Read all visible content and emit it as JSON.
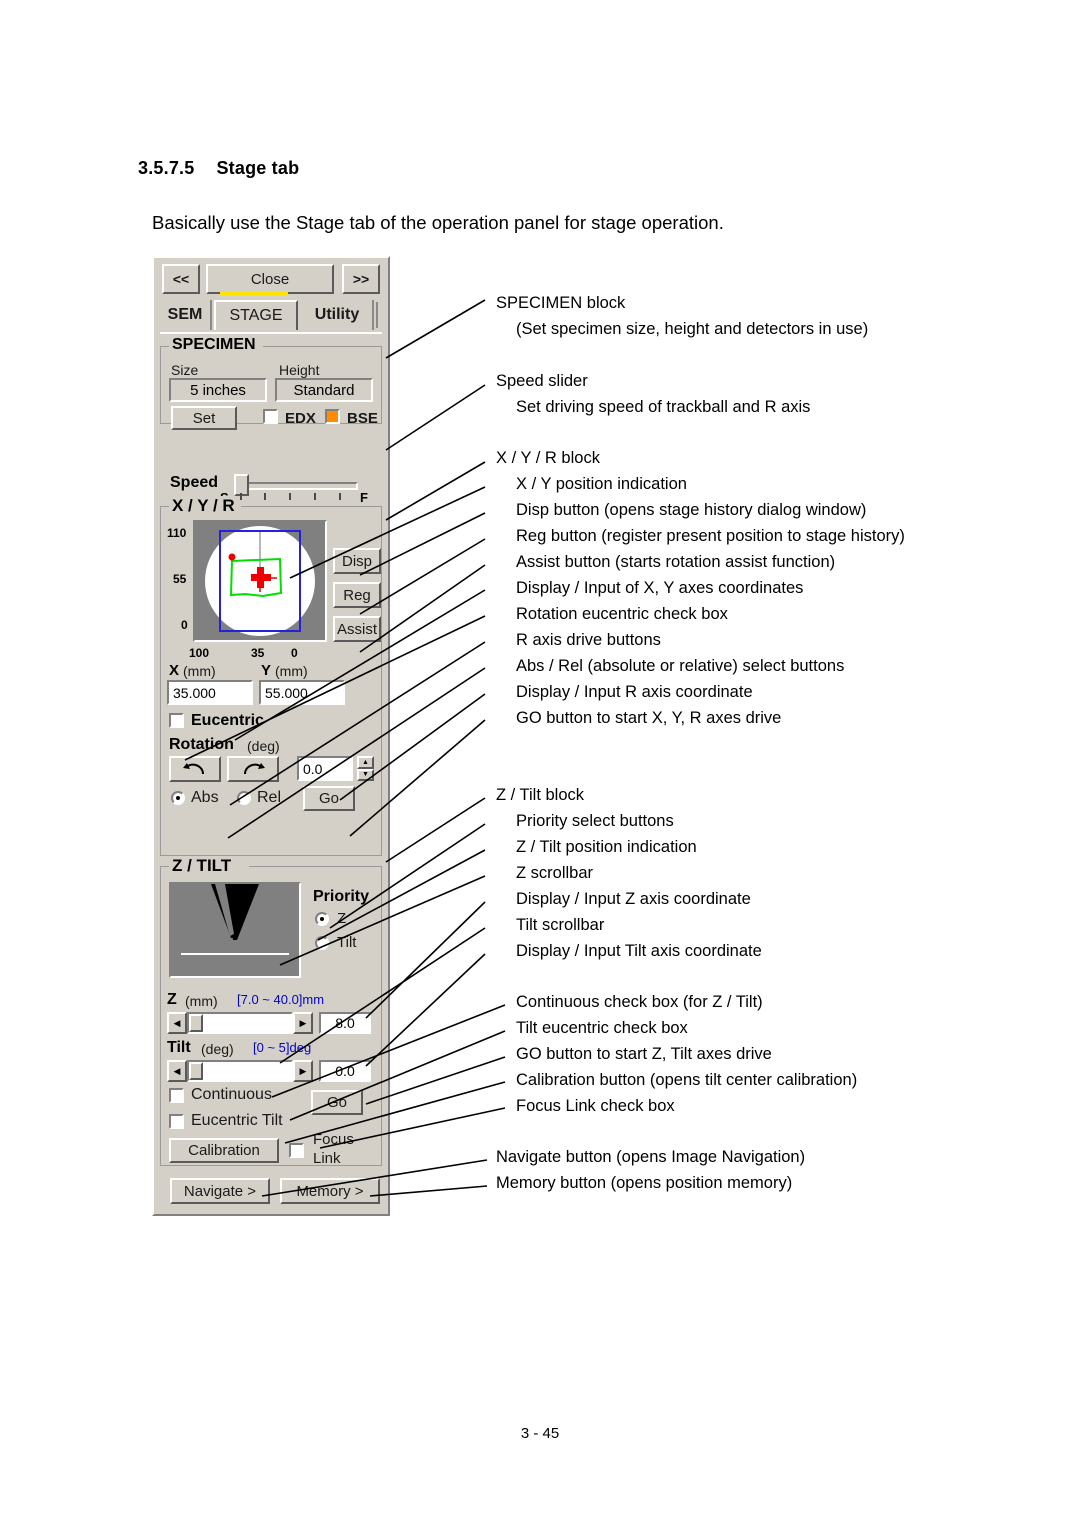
{
  "document": {
    "section_number": "3.5.7.5",
    "section_title": "Stage tab",
    "intro": "Basically use the Stage tab of the operation panel for stage operation.",
    "page_footer": "3 - 45"
  },
  "panel": {
    "topbar": {
      "prev_label": "<<",
      "close_label": "Close",
      "next_label": ">>"
    },
    "tabs": [
      {
        "label": "SEM",
        "active": false
      },
      {
        "label": "STAGE",
        "active": true
      },
      {
        "label": "Utility",
        "active": false
      }
    ],
    "specimen": {
      "title": "SPECIMEN",
      "size_label": "Size",
      "size_value": "5 inches",
      "height_label": "Height",
      "height_value": "Standard",
      "set_label": "Set",
      "edx_label": "EDX",
      "edx_checked": false,
      "bse_label": "BSE",
      "bse_checked": true,
      "bse_color": "#ff8c00"
    },
    "speed": {
      "label": "Speed",
      "slow_label": "S",
      "fast_label": "F",
      "tick_count": 5,
      "thumb_position_pct": 4
    },
    "xyr": {
      "title": "X / Y / R",
      "y_axis_ticks": [
        "110",
        "55",
        "0"
      ],
      "x_axis_ticks": [
        "100",
        "35",
        "0"
      ],
      "disp_label": "Disp",
      "reg_label": "Reg",
      "assist_label": "Assist",
      "x_label": "X",
      "x_unit": "(mm)",
      "x_value": "35.000",
      "y_label": "Y",
      "y_unit": "(mm)",
      "y_value": "55.000",
      "eucentric_label": "Eucentric",
      "eucentric_checked": false,
      "rotation_label": "Rotation",
      "rotation_unit": "(deg)",
      "rotation_value": "0.0",
      "rotate_ccw_icon": "rotate-ccw-icon",
      "rotate_cw_icon": "rotate-cw-icon",
      "abs_label": "Abs",
      "rel_label": "Rel",
      "mode_selected": "Abs",
      "go_label": "Go"
    },
    "ztilt": {
      "title": "Z / TILT",
      "priority_label": "Priority",
      "priority_z_label": "Z",
      "priority_tilt_label": "Tilt",
      "priority_selected": "Z",
      "z_label": "Z",
      "z_unit": "(mm)",
      "z_range": "[7.0 ~ 40.0]mm",
      "z_value": "8.0",
      "tilt_label": "Tilt",
      "tilt_unit": "(deg)",
      "tilt_range": "[0 ~ 5]deg",
      "tilt_value": "0.0",
      "continuous_label": "Continuous",
      "continuous_checked": false,
      "eucentric_tilt_label": "Eucentric Tilt",
      "eucentric_tilt_checked": false,
      "go_label": "Go",
      "calibration_label": "Calibration",
      "focus_link_label_1": "Focus",
      "focus_link_label_2": "Link",
      "focus_link_checked": false
    },
    "bottom": {
      "navigate_label": "Navigate >",
      "memory_label": "Memory >"
    }
  },
  "callouts": [
    {
      "text": "SPECIMEN block",
      "indent": false
    },
    {
      "text": "(Set specimen size, height and detectors in use)",
      "indent": true
    },
    {
      "text": "Speed slider",
      "indent": false
    },
    {
      "text": "Set driving speed of trackball and R axis",
      "indent": true
    },
    {
      "text": "X / Y / R block",
      "indent": false
    },
    {
      "text": "X / Y position indication",
      "indent": true
    },
    {
      "text": "Disp button (opens stage history dialog window)",
      "indent": true
    },
    {
      "text": "Reg button (register present position to stage history)",
      "indent": true
    },
    {
      "text": "Assist button (starts rotation assist function)",
      "indent": true
    },
    {
      "text": "Display / Input of X, Y axes coordinates",
      "indent": true
    },
    {
      "text": "Rotation eucentric check box",
      "indent": true
    },
    {
      "text": "R axis drive buttons",
      "indent": true
    },
    {
      "text": "Abs / Rel (absolute or relative) select buttons",
      "indent": true
    },
    {
      "text": "Display / Input R axis coordinate",
      "indent": true
    },
    {
      "text": "GO button to start X, Y, R axes drive",
      "indent": true
    },
    {
      "text": "Z / Tilt block",
      "indent": false
    },
    {
      "text": "Priority select buttons",
      "indent": true
    },
    {
      "text": "Z / Tilt position indication",
      "indent": true
    },
    {
      "text": "Z scrollbar",
      "indent": true
    },
    {
      "text": "Display / Input Z axis coordinate",
      "indent": true
    },
    {
      "text": "Tilt scrollbar",
      "indent": true
    },
    {
      "text": "Display / Input Tilt axis coordinate",
      "indent": true
    },
    {
      "text": "Continuous check box (for Z / Tilt)",
      "indent": true
    },
    {
      "text": "Tilt eucentric check box",
      "indent": true
    },
    {
      "text": "GO button to start Z, Tilt axes drive",
      "indent": true
    },
    {
      "text": "Calibration button (opens tilt center calibration)",
      "indent": true
    },
    {
      "text": "Focus Link check box",
      "indent": true
    },
    {
      "text": "Navigate button (opens Image Navigation)",
      "indent": false
    },
    {
      "text": "Memory button (opens position memory)",
      "indent": false
    }
  ]
}
